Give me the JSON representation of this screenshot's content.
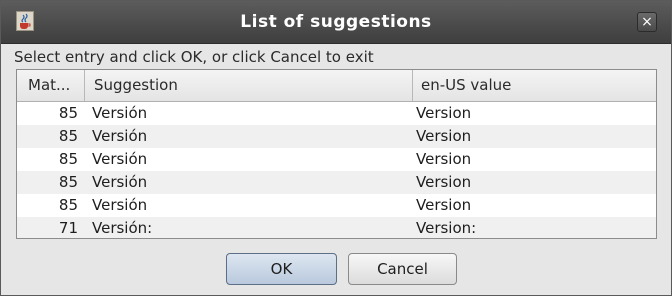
{
  "window": {
    "title": "List of suggestions",
    "close_label": "×",
    "app_icon": "java-coffee-cup-icon"
  },
  "prompt": "Select entry and click OK, or click Cancel to exit",
  "table": {
    "headers": [
      "Mat...",
      "Suggestion",
      "en-US value"
    ],
    "rows": [
      {
        "match": "85",
        "suggestion": "Versión",
        "value": "Version"
      },
      {
        "match": "85",
        "suggestion": "Versión",
        "value": "Version"
      },
      {
        "match": "85",
        "suggestion": "Versión",
        "value": "Version"
      },
      {
        "match": "85",
        "suggestion": "Versión",
        "value": "Version"
      },
      {
        "match": "85",
        "suggestion": "Versión",
        "value": "Version"
      },
      {
        "match": "71",
        "suggestion": "Versión:",
        "value": "Version:"
      }
    ]
  },
  "buttons": {
    "ok": "OK",
    "cancel": "Cancel"
  },
  "colors": {
    "titlebar": "#4a4a4a",
    "dialog_bg": "#e6e6e6",
    "default_button": "#c6d4e5"
  }
}
